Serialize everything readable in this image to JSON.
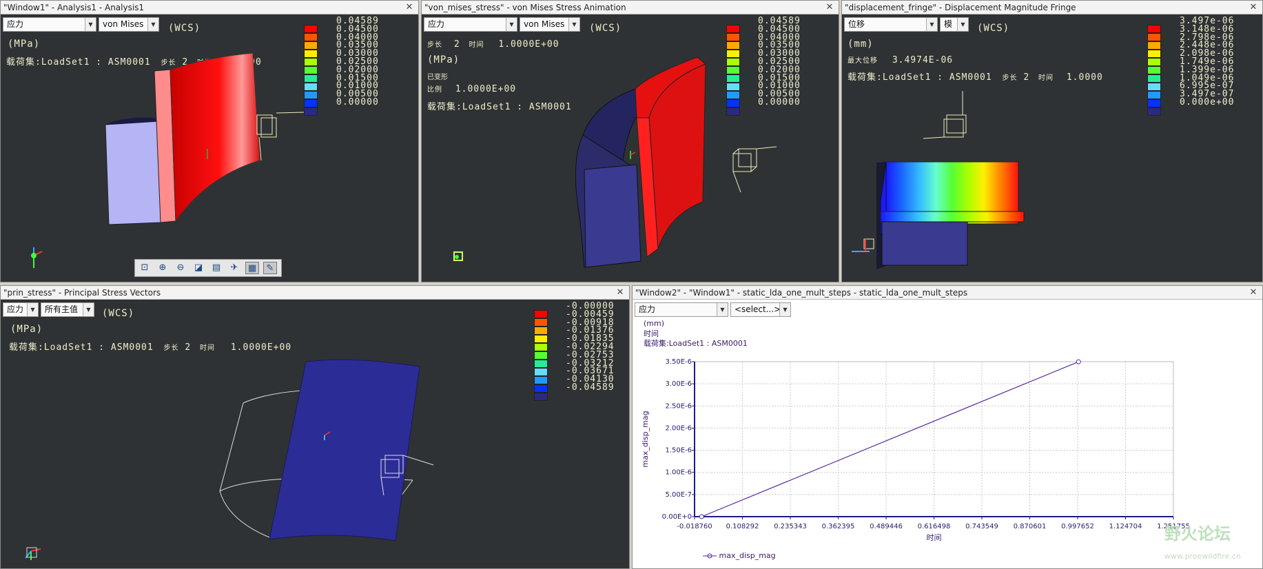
{
  "windows": {
    "w1": {
      "title": "\"Window1\" - Analysis1 - Analysis1",
      "combo1": "应力",
      "combo2": "von Mises",
      "wcs": "(WCS)",
      "unit": "(MPa)",
      "loadset": "载荷集:LoadSet1 :  ASM0001",
      "step_label": "步长",
      "step_value": "2",
      "time_label": "时间",
      "time_value": "1.0000",
      "legend": [
        "0.04589",
        "0.04500",
        "0.04000",
        "0.03500",
        "0.03000",
        "0.02500",
        "0.02000",
        "0.01500",
        "0.01000",
        "0.00500",
        "0.00000"
      ]
    },
    "w2": {
      "title": "\"von_mises_stress\" - von Mises Stress Animation",
      "combo1": "应力",
      "combo2": "von Mises",
      "wcs": "(WCS)",
      "step_label": "步长",
      "step_value": "2",
      "time_label": "时间",
      "time_value": "1.0000E+00",
      "unit": "(MPa)",
      "deformed": "已变形",
      "scale_label": "比例",
      "scale_value": "1.0000E+00",
      "loadset": "载荷集:LoadSet1 :  ASM0001",
      "legend": [
        "0.04589",
        "0.04500",
        "0.04000",
        "0.03500",
        "0.03000",
        "0.02500",
        "0.02000",
        "0.01500",
        "0.01000",
        "0.00500",
        "0.00000"
      ]
    },
    "w3": {
      "title": "\"displacement_fringe\" - Displacement Magnitude Fringe",
      "combo1": "位移",
      "combo2": "模",
      "wcs": "(WCS)",
      "unit": "(mm)",
      "max_label": "最大位移",
      "max_value": "3.4974E-06",
      "loadset": "载荷集:LoadSet1 :  ASM0001",
      "step_label": "步长",
      "step_value": "2",
      "time_label": "时间",
      "time_value": "1.0000",
      "legend": [
        "3.497e-06",
        "3.148e-06",
        "2.798e-06",
        "2.448e-06",
        "2.098e-06",
        "1.749e-06",
        "1.399e-06",
        "1.049e-06",
        "6.995e-07",
        "3.497e-07",
        "0.000e+00"
      ]
    },
    "w4": {
      "title": "\"prin_stress\" - Principal Stress Vectors",
      "combo1": "应力",
      "combo2": "所有主值",
      "wcs": "(WCS)",
      "unit": "(MPa)",
      "loadset": "载荷集:LoadSet1 :  ASM0001",
      "step_label": "步长",
      "step_value": "2",
      "time_label": "时间",
      "time_value": "1.0000E+00",
      "legend": [
        "-0.00000",
        "-0.00459",
        "-0.00918",
        "-0.01376",
        "-0.01835",
        "-0.02294",
        "-0.02753",
        "-0.03212",
        "-0.03671",
        "-0.04130",
        "-0.04589"
      ]
    },
    "w5": {
      "title": "\"Window2\" - \"Window1\" - static_lda_one_mult_steps - static_lda_one_mult_steps",
      "combo1": "应力",
      "combo2": "<select...>",
      "header_unit": "(mm)",
      "header_time": "时间",
      "header_loadset": "载荷集:LoadSet1 : ASM0001",
      "legend_label": "max_disp_mag"
    }
  },
  "toolbar_icons": [
    "zoom-fit-icon",
    "zoom-in-icon",
    "zoom-out-icon",
    "refit-icon",
    "print-icon",
    "spin-icon",
    "display-style-icon",
    "settings-icon"
  ],
  "watermark": {
    "title": "野火论坛",
    "url": "www.proewildfire.cn"
  },
  "colors": {
    "viewport_bg": "#2f3234",
    "legend": [
      "#ff0000",
      "#ff5500",
      "#ffaa00",
      "#ffee00",
      "#aaff00",
      "#55ff33",
      "#22ee99",
      "#66ddff",
      "#2299ff",
      "#0033ff",
      "#2a2a80"
    ]
  },
  "chart_data": {
    "type": "line",
    "title": "",
    "xlabel": "时间",
    "ylabel": "max_disp_mag",
    "x_ticks": [
      "-0.018760",
      "0.108292",
      "0.235343",
      "0.362395",
      "0.489446",
      "0.616498",
      "0.743549",
      "0.870601",
      "0.997652",
      "1.124704",
      "1.251755"
    ],
    "y_ticks": [
      "0.00E+0",
      "5.00E-7",
      "1.00E-6",
      "1.50E-6",
      "2.00E-6",
      "2.50E-6",
      "3.00E-6",
      "3.50E-6"
    ],
    "xlim": [
      -0.01876,
      1.251755
    ],
    "ylim": [
      0,
      3.5e-06
    ],
    "grid": true,
    "legend_position": "bottom-left",
    "series": [
      {
        "name": "max_disp_mag",
        "x": [
          0.0,
          1.0
        ],
        "y": [
          0.0,
          3.4974e-06
        ],
        "color": "#5a2a9a"
      }
    ]
  }
}
